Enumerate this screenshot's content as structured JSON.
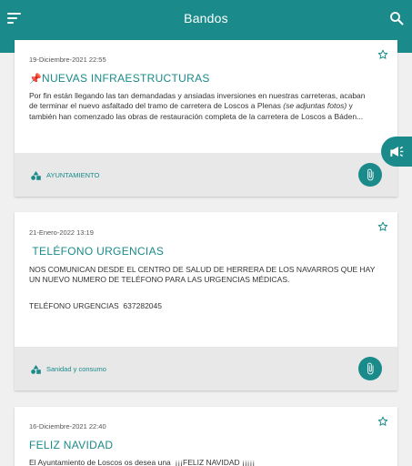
{
  "appbar": {
    "title": "Bandos"
  },
  "colors": {
    "accent": "#1b8a8a",
    "footer_bg": "#e8e8e8"
  },
  "cards": [
    {
      "date": "19-Diciembre-2021 22:55",
      "title_emoji": "📌",
      "title": "NUEVAS INFRAESTRUCTURAS",
      "text_part1": "Por fin están llegando las tan demandadas y ansiadas inversiones en nuestras carreteras,  acaban de terminar el nuevo asfaltado del tramo de carretera de Loscos a Plenas ",
      "text_italic": "(se adjuntas fotos)",
      "text_part2": " y también han comenzado las obras de restauración completa de la carretera de Loscos a Báden...",
      "category": "AYUNTAMIENTO",
      "category_icon": "shapes-icon",
      "attachment_icon": "paperclip-icon",
      "favorite_icon": "star-outline-icon"
    },
    {
      "date": "21-Enero-2022 13:19",
      "title": " TELÉFONO URGENCIAS",
      "text_line1": "NOS COMUNICAN DESDE EL CENTRO DE SALUD DE HERRERA DE LOS NAVARROS QUE HAY UN NUEVO NUMERO DE TELÉFONO PARA LAS URGENCIAS MÉDICAS.",
      "text_line2": "TELÉFONO URGENCIAS  637282045",
      "category": "Sanidad y consumo",
      "category_icon": "shapes-icon",
      "attachment_icon": "paperclip-icon",
      "favorite_icon": "star-outline-icon"
    },
    {
      "date": "16-Diciembre-2021 22:40",
      "title": "FELIZ NAVIDAD",
      "text": "El Ayuntamiento de Loscos os desea una  ¡¡¡FELIZ NAVIDAD ¡¡¡¡¡",
      "favorite_icon": "star-outline-icon"
    }
  ],
  "fab": {
    "icon": "megaphone-icon"
  }
}
